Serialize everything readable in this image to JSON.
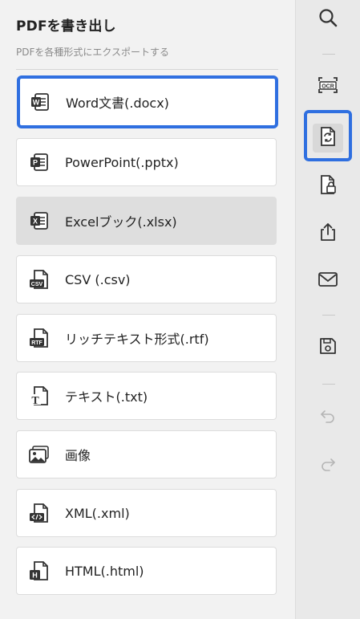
{
  "panel": {
    "title": "PDFを書き出し",
    "subtitle": "PDFを各種形式にエクスポートする",
    "items": [
      {
        "label": "Word文書(.docx)",
        "icon": "word-icon"
      },
      {
        "label": "PowerPoint(.pptx)",
        "icon": "powerpoint-icon"
      },
      {
        "label": "Excelブック(.xlsx)",
        "icon": "excel-icon"
      },
      {
        "label": "CSV (.csv)",
        "icon": "csv-icon"
      },
      {
        "label": "リッチテキスト形式(.rtf)",
        "icon": "rtf-icon"
      },
      {
        "label": "テキスト(.txt)",
        "icon": "text-icon"
      },
      {
        "label": "画像",
        "icon": "image-icon"
      },
      {
        "label": "XML(.xml)",
        "icon": "xml-icon"
      },
      {
        "label": "HTML(.html)",
        "icon": "html-icon"
      }
    ]
  },
  "rail": {
    "buttons": [
      "search-icon",
      "ocr-icon",
      "convert-icon",
      "protect-icon",
      "share-icon",
      "mail-icon",
      "save-icon",
      "undo-icon",
      "redo-icon"
    ],
    "ocr_label": "OCR"
  },
  "colors": {
    "accent": "#2f6fe0",
    "hover": "#dedede",
    "panel_bg": "#f2f2f2",
    "rail_bg": "#e9e9e9"
  }
}
